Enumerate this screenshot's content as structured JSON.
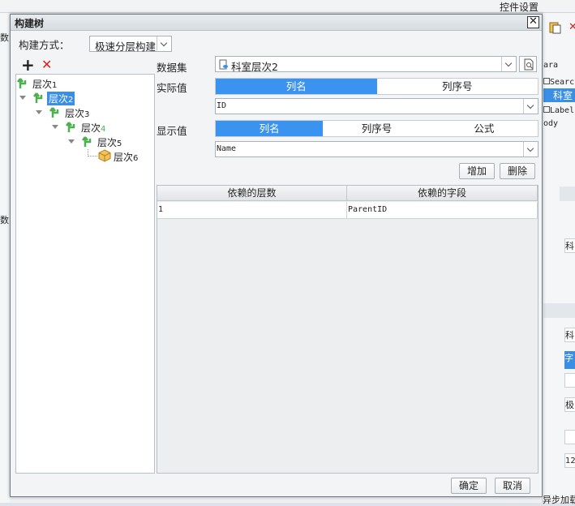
{
  "background": {
    "toolbar_label": "控件设置",
    "left_label_1": "数",
    "left_label_2": "数",
    "right_items": [
      "ara",
      "Searc",
      "科室",
      "Label",
      "ody"
    ],
    "right_field_1": "科",
    "right_field_2": "科",
    "right_field_3": "字",
    "right_field_4": "极",
    "right_field_5": "12",
    "bottom_label": "异步加载"
  },
  "dialog": {
    "title": "构建树",
    "close_glyph": "✕",
    "build_mode_label": "构建方式：",
    "build_mode_value": "极速分层构建",
    "add_glyph": "+",
    "delete_glyph": "✕",
    "tree": [
      {
        "label": "层次",
        "num": "1"
      },
      {
        "label": "层次",
        "num": "2"
      },
      {
        "label": "层次",
        "num": "3"
      },
      {
        "label": "层次",
        "num": "4"
      },
      {
        "label": "层次",
        "num": "5"
      },
      {
        "label": "层次",
        "num": "6"
      }
    ],
    "dataset_label": "数据集",
    "dataset_value": "科室层次2",
    "actual_label": "实际值",
    "actual_tabs": [
      "列名",
      "列序号"
    ],
    "actual_value": "ID",
    "display_label": "显示值",
    "display_tabs": [
      "列名",
      "列序号",
      "公式"
    ],
    "display_value": "Name",
    "add_button": "增加",
    "delete_button": "删除",
    "table": {
      "headers": [
        "依赖的层数",
        "依赖的字段"
      ],
      "rows": [
        [
          "1",
          "ParentID"
        ]
      ]
    },
    "ok_button": "确定",
    "cancel_button": "取消"
  },
  "colors": {
    "accent": "#3a93ef",
    "tree_icon": "#4caf50",
    "delete": "#e02020"
  }
}
